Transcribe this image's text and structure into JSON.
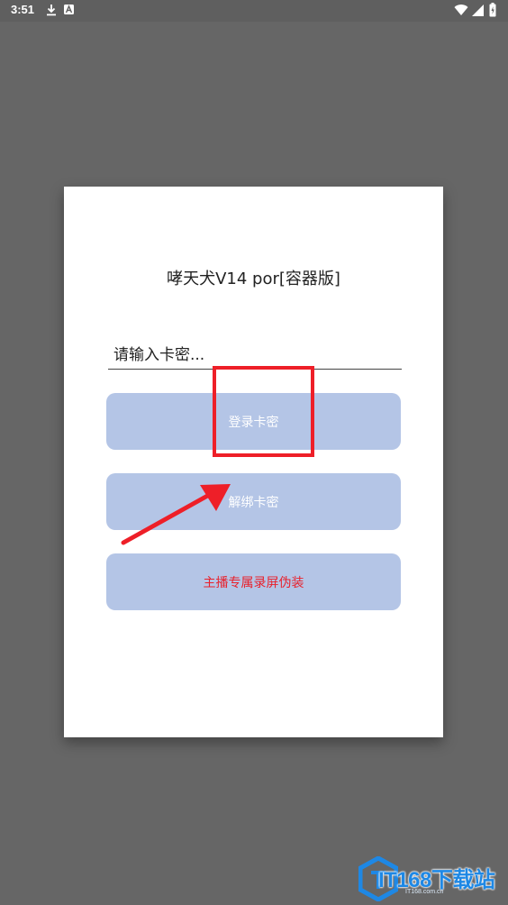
{
  "status_bar": {
    "time": "3:51"
  },
  "dialog": {
    "title": "哮天犬V14 por[容器版]",
    "input_placeholder": "请输入卡密...",
    "buttons": {
      "login": "登录卡密",
      "unbind": "解绑卡密",
      "disguise": "主播专属录屏伪装"
    }
  },
  "watermark": {
    "text_latin": "IT168",
    "text_cn": "下载站",
    "sub": "IT168.com.cn"
  },
  "colors": {
    "background": "#666666",
    "button_bg": "#b4c5e6",
    "disguise_text": "#e8222d",
    "annotation_red": "#ee1f28"
  }
}
